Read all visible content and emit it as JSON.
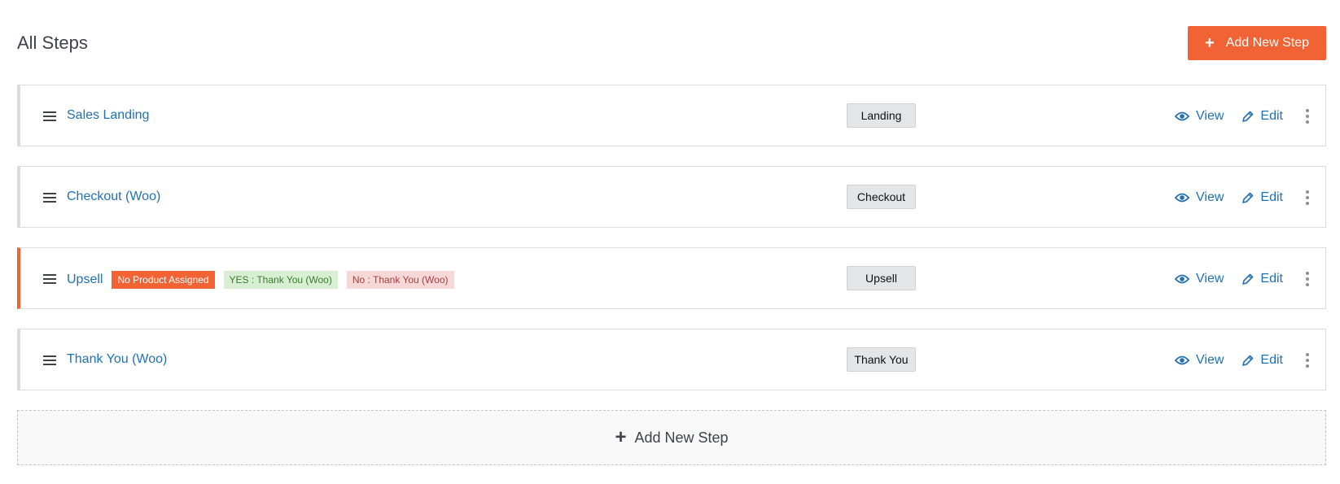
{
  "header": {
    "title": "All Steps",
    "add_button_icon": "+",
    "add_button_label": "Add New Step"
  },
  "steps": [
    {
      "name": "Sales Landing",
      "type": "Landing",
      "view_label": "View",
      "edit_label": "Edit",
      "tags": []
    },
    {
      "name": "Checkout (Woo)",
      "type": "Checkout",
      "view_label": "View",
      "edit_label": "Edit",
      "tags": []
    },
    {
      "name": "Upsell",
      "type": "Upsell",
      "view_label": "View",
      "edit_label": "Edit",
      "tags": [
        "No Product Assigned",
        "YES : Thank You (Woo)",
        "No : Thank You (Woo)"
      ]
    },
    {
      "name": "Thank You (Woo)",
      "type": "Thank You",
      "view_label": "View",
      "edit_label": "Edit",
      "tags": []
    }
  ],
  "footer": {
    "add_step_icon": "+",
    "add_step_label": "Add New Step"
  },
  "icons": {
    "drag": "drag-handle-icon",
    "view": "eye-icon",
    "edit": "pencil-icon",
    "more": "more-vertical-icon",
    "add": "plus-icon"
  },
  "colors": {
    "accent": "#f16334",
    "link": "#2271b1",
    "yes_tag_bg": "#d8efd3",
    "no_tag_bg": "#f6d8d8"
  }
}
